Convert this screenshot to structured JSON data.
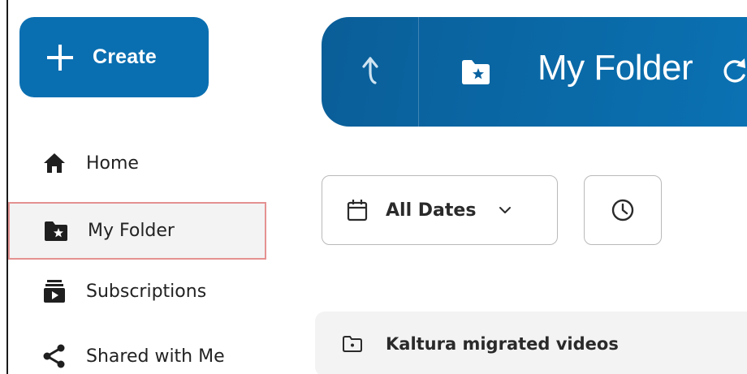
{
  "create_button": {
    "label": "Create"
  },
  "sidebar": {
    "items": [
      {
        "label": "Home",
        "icon": "home-icon"
      },
      {
        "label": "My Folder",
        "icon": "star-folder-icon",
        "active": true
      },
      {
        "label": "Subscriptions",
        "icon": "subscriptions-icon"
      },
      {
        "label": "Shared with Me",
        "icon": "share-icon"
      }
    ]
  },
  "header": {
    "title": "My Folder",
    "icons": [
      "up-arrow-icon",
      "star-folder-icon",
      "refresh-icon"
    ],
    "color": "#0a6aa8"
  },
  "filters": {
    "date_label": "All Dates",
    "date_icon": "calendar-icon",
    "clock_icon": "clock-icon"
  },
  "content": {
    "folders": [
      {
        "name": "Kaltura migrated videos",
        "icon": "folder-icon"
      }
    ]
  },
  "colors": {
    "accent": "#0a6fb1",
    "active_border": "#e59191"
  }
}
